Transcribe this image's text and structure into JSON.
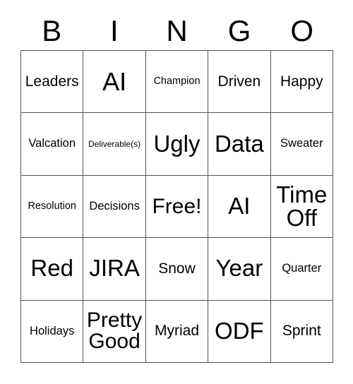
{
  "card": {
    "title": "BINGO",
    "headers": [
      "B",
      "I",
      "N",
      "G",
      "O"
    ],
    "grid_colors": {
      "border": "#555555",
      "cell_background": "#ffffff",
      "text": "#000000",
      "page_background": "#ffffff"
    },
    "rows": [
      [
        {
          "label": "Leaders",
          "size": "md",
          "wrap": false
        },
        {
          "label": "AI",
          "size": "3xl",
          "wrap": false
        },
        {
          "label": "Champion",
          "size": "xs",
          "wrap": false
        },
        {
          "label": "Driven",
          "size": "md",
          "wrap": false
        },
        {
          "label": "Happy",
          "size": "md",
          "wrap": false
        }
      ],
      [
        {
          "label": "Valcation",
          "size": "sm",
          "wrap": false
        },
        {
          "label": "Deliverable(s)",
          "size": "xxs",
          "wrap": false
        },
        {
          "label": "Ugly",
          "size": "xxl",
          "wrap": false
        },
        {
          "label": "Data",
          "size": "xxl",
          "wrap": false
        },
        {
          "label": "Sweater",
          "size": "sm",
          "wrap": false
        }
      ],
      [
        {
          "label": "Resolution",
          "size": "xs",
          "wrap": false
        },
        {
          "label": "Decisions",
          "size": "sm",
          "wrap": false
        },
        {
          "label": "Free!",
          "size": "xl",
          "wrap": false
        },
        {
          "label": "AI",
          "size": "xxl",
          "wrap": false
        },
        {
          "label": "Time Off",
          "size": "xxl",
          "wrap": true
        }
      ],
      [
        {
          "label": "Red",
          "size": "xxl",
          "wrap": false
        },
        {
          "label": "JIRA",
          "size": "xxl",
          "wrap": false
        },
        {
          "label": "Snow",
          "size": "md",
          "wrap": false
        },
        {
          "label": "Year",
          "size": "xxl",
          "wrap": false
        },
        {
          "label": "Quarter",
          "size": "sm",
          "wrap": false
        }
      ],
      [
        {
          "label": "Holidays",
          "size": "sm",
          "wrap": false
        },
        {
          "label": "Pretty Good",
          "size": "xl",
          "wrap": true
        },
        {
          "label": "Myriad",
          "size": "md",
          "wrap": false
        },
        {
          "label": "ODF",
          "size": "xxl",
          "wrap": false
        },
        {
          "label": "Sprint",
          "size": "md",
          "wrap": false
        }
      ]
    ],
    "free_space": "Free!"
  }
}
